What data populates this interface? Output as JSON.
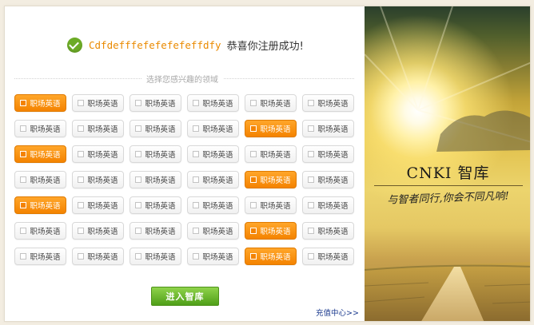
{
  "header": {
    "username": "Cdfdefffefefefefeffdfy",
    "congrats": "恭喜你注册成功!"
  },
  "interests": {
    "label": "选择您感兴趣的领域",
    "rows": [
      [
        {
          "label": "职场英语",
          "selected": true
        },
        {
          "label": "职场英语",
          "selected": false
        },
        {
          "label": "职场英语",
          "selected": false
        },
        {
          "label": "职场英语",
          "selected": false
        },
        {
          "label": "职场英语",
          "selected": false
        },
        {
          "label": "职场英语",
          "selected": false
        }
      ],
      [
        {
          "label": "职场英语",
          "selected": false
        },
        {
          "label": "职场英语",
          "selected": false
        },
        {
          "label": "职场英语",
          "selected": false
        },
        {
          "label": "职场英语",
          "selected": false
        },
        {
          "label": "职场英语",
          "selected": true
        },
        {
          "label": "职场英语",
          "selected": false
        }
      ],
      [
        {
          "label": "职场英语",
          "selected": true
        },
        {
          "label": "职场英语",
          "selected": false
        },
        {
          "label": "职场英语",
          "selected": false
        },
        {
          "label": "职场英语",
          "selected": false
        },
        {
          "label": "职场英语",
          "selected": false
        },
        {
          "label": "职场英语",
          "selected": false
        }
      ],
      [
        {
          "label": "职场英语",
          "selected": false
        },
        {
          "label": "职场英语",
          "selected": false
        },
        {
          "label": "职场英语",
          "selected": false
        },
        {
          "label": "职场英语",
          "selected": false
        },
        {
          "label": "职场英语",
          "selected": true
        },
        {
          "label": "职场英语",
          "selected": false
        }
      ],
      [
        {
          "label": "职场英语",
          "selected": true
        },
        {
          "label": "职场英语",
          "selected": false
        },
        {
          "label": "职场英语",
          "selected": false
        },
        {
          "label": "职场英语",
          "selected": false
        },
        {
          "label": "职场英语",
          "selected": false
        },
        {
          "label": "职场英语",
          "selected": false
        }
      ],
      [
        {
          "label": "职场英语",
          "selected": false
        },
        {
          "label": "职场英语",
          "selected": false
        },
        {
          "label": "职场英语",
          "selected": false
        },
        {
          "label": "职场英语",
          "selected": false
        },
        {
          "label": "职场英语",
          "selected": true
        },
        {
          "label": "职场英语",
          "selected": false
        }
      ],
      [
        {
          "label": "职场英语",
          "selected": false
        },
        {
          "label": "职场英语",
          "selected": false
        },
        {
          "label": "职场英语",
          "selected": false
        },
        {
          "label": "职场英语",
          "selected": false
        },
        {
          "label": "职场英语",
          "selected": true
        },
        {
          "label": "职场英语",
          "selected": false
        }
      ]
    ]
  },
  "actions": {
    "enter_label": "进入智库",
    "recharge_label": "充值中心>>"
  },
  "banner": {
    "title": "CNKI 智库",
    "slogan": "与智者同行,你会不同凡响!"
  },
  "colors": {
    "accent_orange": "#f48300",
    "success_green": "#6cab26",
    "button_green": "#4f9f18",
    "link_blue": "#1c3b8f"
  },
  "icons": {
    "success": "check-circle-icon",
    "tag_checkbox": "checkbox-icon"
  }
}
